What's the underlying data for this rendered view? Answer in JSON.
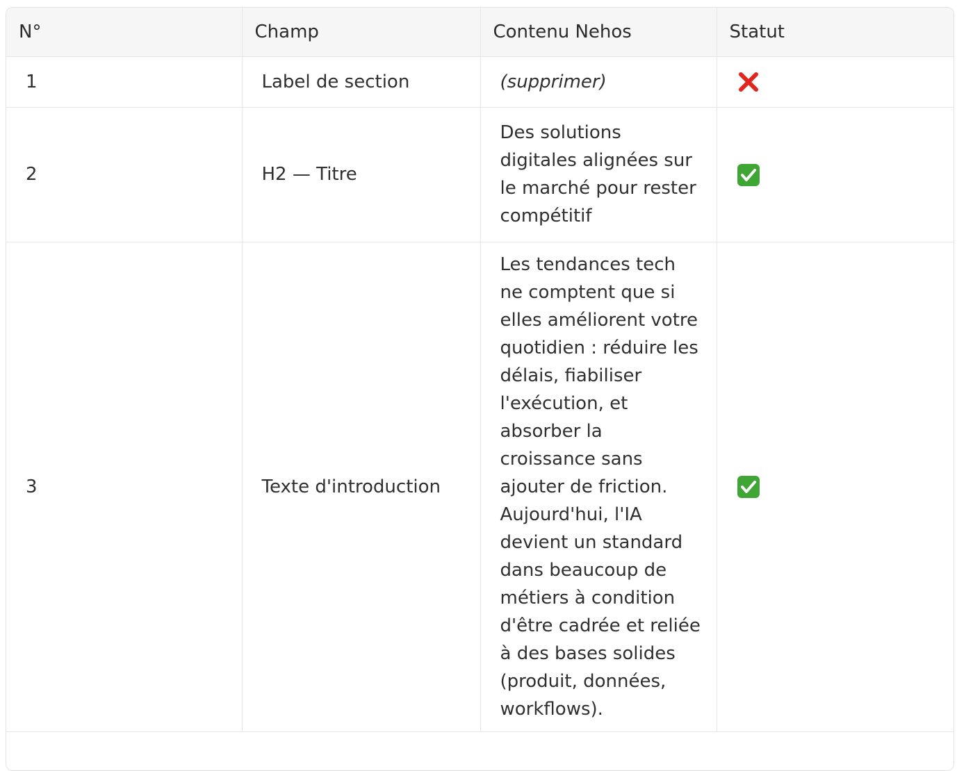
{
  "table": {
    "headers": [
      "N°",
      "Champ",
      "Contenu Nehos",
      "Statut"
    ],
    "rows": [
      {
        "num": "1",
        "champ": "Label de section",
        "contenu": "(supprimer)",
        "statut": "cross-mark-icon"
      },
      {
        "num": "2",
        "champ": "H2 — Titre",
        "contenu": "Des solutions digitales alignées sur le marché pour rester compétitif",
        "statut": "check-mark-icon"
      },
      {
        "num": "3",
        "champ": "Texte d'introduction",
        "contenu": "Les tendances tech ne comptent que si elles améliorent votre quotidien : réduire les délais, fiabiliser l'exécution, et absorber la croissance sans ajouter de friction. Aujourd'hui, l'IA devient un standard dans beaucoup de métiers à condition d'être cadrée et reliée à des bases solides (produit, données, workflows).",
        "statut": "check-mark-icon"
      }
    ]
  },
  "colors": {
    "header_bg": "#f6f6f6",
    "border": "#e6e6e6",
    "cross_red": "#e0261f",
    "check_green": "#3fa535"
  }
}
